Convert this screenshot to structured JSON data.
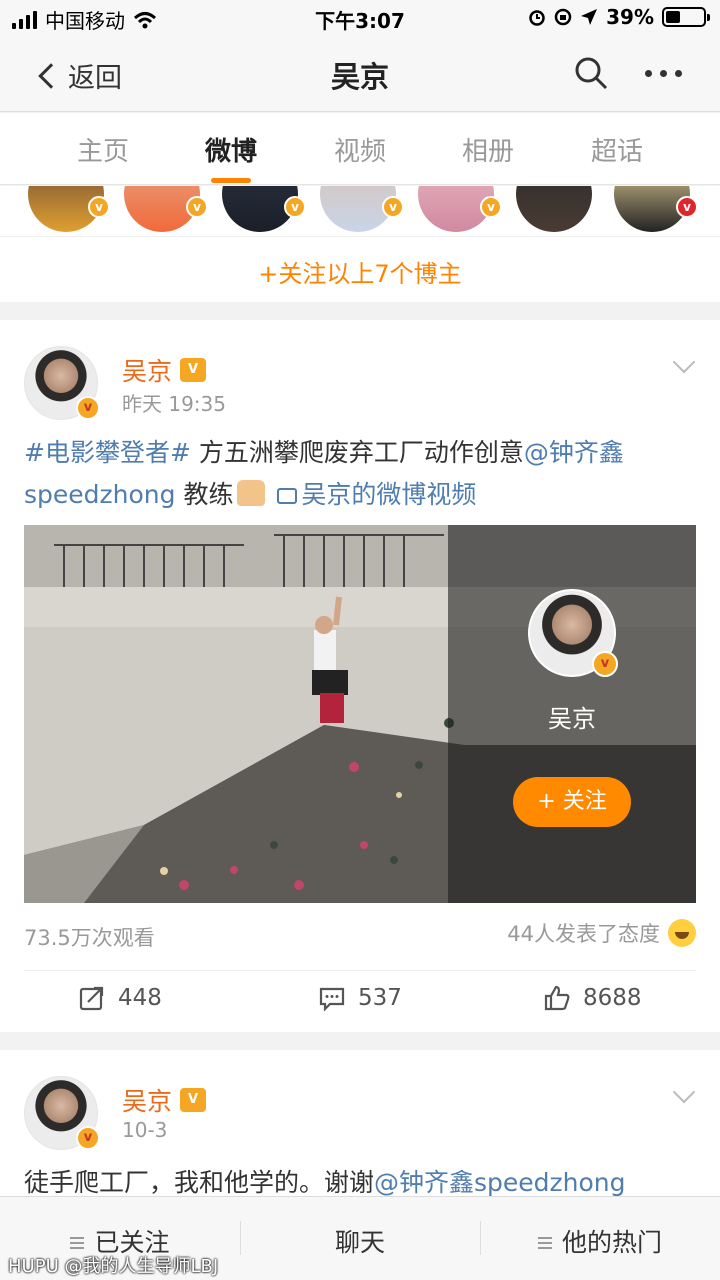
{
  "status_bar": {
    "carrier": "中国移动",
    "time": "下午3:07",
    "battery": "39%"
  },
  "nav": {
    "back_label": "返回",
    "title": "吴京"
  },
  "tabs": [
    {
      "label": "主页"
    },
    {
      "label": "微博"
    },
    {
      "label": "视频"
    },
    {
      "label": "相册"
    },
    {
      "label": "超话"
    }
  ],
  "recommend": {
    "follow_all": "+关注以上7个博主"
  },
  "post1": {
    "user": "吴京",
    "time": "昨天 19:35",
    "hashtag": "#电影攀登者#",
    "text": " 方五洲攀爬废弃工厂动作创意",
    "mention": "@钟齐鑫speedzhong",
    "text2": " 教练",
    "video_link": "吴京的微博视频",
    "video_overlay_name": "吴京",
    "video_follow": "+ 关注",
    "views": "73.5万次观看",
    "reactions": "44人发表了态度",
    "reposts": "448",
    "comments": "537",
    "likes": "8688"
  },
  "post2": {
    "user": "吴京",
    "time": "10-3",
    "text": "徒手爬工厂，我和他学的。谢谢",
    "mention": "@钟齐鑫speedzhong"
  },
  "bottom_bar": {
    "followed": "已关注",
    "chat": "聊天",
    "hot": "他的热门"
  },
  "watermark": "HUPU @我的人生导师LBJ",
  "colors": {
    "accent": "#ff8200",
    "link": "#507daf",
    "username": "#e86a1a"
  }
}
